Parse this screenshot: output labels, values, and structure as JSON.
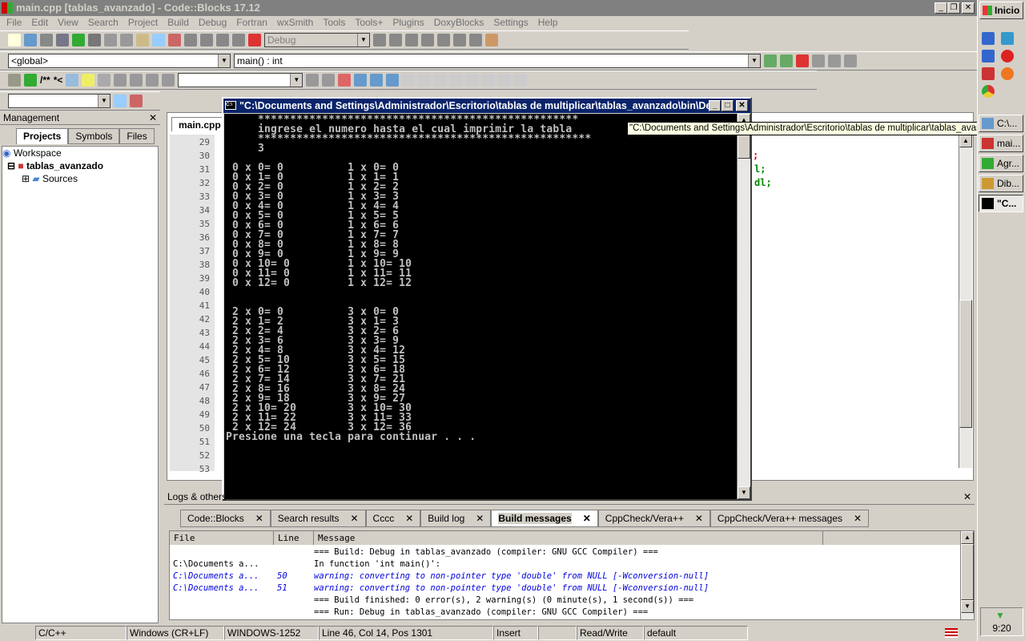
{
  "window": {
    "title": "main.cpp [tablas_avanzado] - Code::Blocks 17.12"
  },
  "menu": [
    "File",
    "Edit",
    "View",
    "Search",
    "Project",
    "Build",
    "Debug",
    "Fortran",
    "wxSmith",
    "Tools",
    "Tools+",
    "Plugins",
    "DoxyBlocks",
    "Settings",
    "Help"
  ],
  "toolbar": {
    "build_target": "Debug",
    "scope": "<global>",
    "function": "main() : int",
    "comment1": "/**",
    "comment2": "*<"
  },
  "management": {
    "title": "Management",
    "tabs": [
      "Projects",
      "Symbols",
      "Files"
    ],
    "tree": {
      "workspace": "Workspace",
      "project": "tablas_avanzado",
      "folder": "Sources"
    }
  },
  "editor": {
    "tab": "main.cpp",
    "line_numbers": [
      "29",
      "30",
      "31",
      "32",
      "33",
      "34",
      "35",
      "36",
      "37",
      "38",
      "39",
      "40",
      "41",
      "42",
      "43",
      "44",
      "45",
      "46",
      "47",
      "48",
      "49",
      "50",
      "51",
      "52",
      "53"
    ],
    "code_fragments": [
      ";",
      "l;",
      "dl;"
    ]
  },
  "console": {
    "title": "\"C:\\Documents and Settings\\Administrador\\Escritorio\\tablas de multiplicar\\tablas_avanzado\\bin\\De...",
    "lines": [
      "     **************************************************",
      "     ingrese el numero hasta el cual imprimir la tabla",
      "     ****************************************************",
      "     3",
      "",
      " 0 x 0= 0          1 x 0= 0",
      " 0 x 1= 0          1 x 1= 1",
      " 0 x 2= 0          1 x 2= 2",
      " 0 x 3= 0          1 x 3= 3",
      " 0 x 4= 0          1 x 4= 4",
      " 0 x 5= 0          1 x 5= 5",
      " 0 x 6= 0          1 x 6= 6",
      " 0 x 7= 0          1 x 7= 7",
      " 0 x 8= 0          1 x 8= 8",
      " 0 x 9= 0          1 x 9= 9",
      " 0 x 10= 0         1 x 10= 10",
      " 0 x 11= 0         1 x 11= 11",
      " 0 x 12= 0         1 x 12= 12",
      "",
      "",
      " 2 x 0= 0          3 x 0= 0",
      " 2 x 1= 2          3 x 1= 3",
      " 2 x 2= 4          3 x 2= 6",
      " 2 x 3= 6          3 x 3= 9",
      " 2 x 4= 8          3 x 4= 12",
      " 2 x 5= 10         3 x 5= 15",
      " 2 x 6= 12         3 x 6= 18",
      " 2 x 7= 14         3 x 7= 21",
      " 2 x 8= 16         3 x 8= 24",
      " 2 x 9= 18         3 x 9= 27",
      " 2 x 10= 20        3 x 10= 30",
      " 2 x 11= 22        3 x 11= 33",
      " 2 x 12= 24        3 x 12= 36",
      "Presione una tecla para continuar . . ."
    ]
  },
  "tooltip": "\"C:\\Documents and Settings\\Administrador\\Escritorio\\tablas de multiplicar\\tablas_avanzado\\bin\\Debug",
  "logs": {
    "title": "Logs & others",
    "tabs": [
      "Code::Blocks",
      "Search results",
      "Cccc",
      "Build log",
      "Build messages",
      "CppCheck/Vera++",
      "CppCheck/Vera++ messages"
    ],
    "active_tab": "Build messages",
    "columns": [
      "File",
      "Line",
      "Message"
    ],
    "rows": [
      {
        "file": "",
        "line": "",
        "message": "=== Build: Debug in tablas_avanzado (compiler: GNU GCC Compiler) ===",
        "type": "info"
      },
      {
        "file": "C:\\Documents a...",
        "line": "",
        "message": "In function 'int main()':",
        "type": "info"
      },
      {
        "file": "C:\\Documents a...",
        "line": "50",
        "message": "warning: converting to non-pointer type 'double' from NULL [-Wconversion-null]",
        "type": "warn"
      },
      {
        "file": "C:\\Documents a...",
        "line": "51",
        "message": "warning: converting to non-pointer type 'double' from NULL [-Wconversion-null]",
        "type": "warn"
      },
      {
        "file": "",
        "line": "",
        "message": "=== Build finished: 0 error(s), 2 warning(s) (0 minute(s), 1 second(s)) ===",
        "type": "info"
      },
      {
        "file": "",
        "line": "",
        "message": "=== Run: Debug in tablas_avanzado (compiler: GNU GCC Compiler) ===",
        "type": "info"
      }
    ]
  },
  "status": [
    "C/C++",
    "Windows (CR+LF)",
    "WINDOWS-1252",
    "Line 46, Col 14, Pos 1301",
    "Insert",
    "",
    "Read/Write",
    "default"
  ],
  "taskbar": {
    "start": "Inicio",
    "tasks": [
      "C:\\...",
      "mai...",
      "Agr...",
      "Dib...",
      "\"C..."
    ],
    "clock": "9:20"
  },
  "colors": {
    "console_title": "#0a246a",
    "warning": "#0000e0",
    "code_green": "#008000"
  }
}
